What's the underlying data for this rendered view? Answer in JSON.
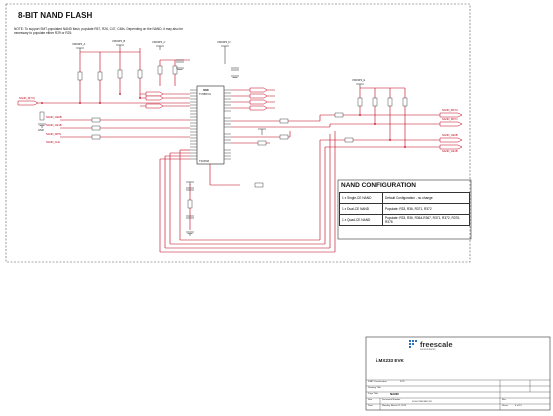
{
  "title": "8-BIT NAND FLASH",
  "note": "NOTE: To support SMT-populated NAND flash, populate R57, R26, C47, C48s. Depending on the NAND, it may also be necessary to populate either R29 or R25.",
  "nets": {
    "left_signal": "NAND_D[7:0]",
    "right_a": "NAND_RDY0",
    "right_b": "NAND_RDY1",
    "right_c": "NAND_CE0B",
    "right_d": "NAND_CE1B",
    "left_ctrl": [
      "NAND_CE0B",
      "NAND_CE1B",
      "NAND_WPN",
      "NAND_CLE"
    ]
  },
  "power": {
    "rail_a": "VDD3P3_A",
    "rail_b": "VDD3P3_B",
    "rail_c": "VDD3P3_C",
    "rail_d": "VDD3P3_D",
    "rail_e": "VDD3P3_E",
    "gnd": "GND"
  },
  "chip": {
    "refdes": "U60",
    "part": "TC58NVG",
    "footprint": "TSOP48"
  },
  "config": {
    "title": "NAND CONFIGURATION",
    "rows": [
      {
        "type": "1 x Single-CE NAND",
        "action": "Default Configuration - no change"
      },
      {
        "type": "1 x Dual-CE NAND",
        "action": "Populate: R33, R36, R371, R372"
      },
      {
        "type": "1 x Quad-CE NAND",
        "action": "Populate: R33, R36, R364-R367, R371, R372, R375-R376"
      }
    ]
  },
  "title_block": {
    "brand": "freescale",
    "brand_sub": "semiconductor",
    "board": "i.MX233 EVK",
    "page_label": "Page Title:",
    "page_value": "NAND",
    "size_label": "Size",
    "doc_label": "Document Number",
    "doc_value": "SCH-27468 REV B1",
    "date_label": "Date:",
    "date_value": "Monday, March 01, 2010",
    "sheet_label": "Sheet",
    "sheet_value": "4 of 15",
    "class_label": "ICAP Classification:",
    "class_value": "FCP:",
    "drawing_label": "Drawing Title:",
    "rev_label": "Rev"
  },
  "colors": {
    "wire": "#c0001a",
    "ink": "#111111",
    "dashed": "#555555"
  }
}
